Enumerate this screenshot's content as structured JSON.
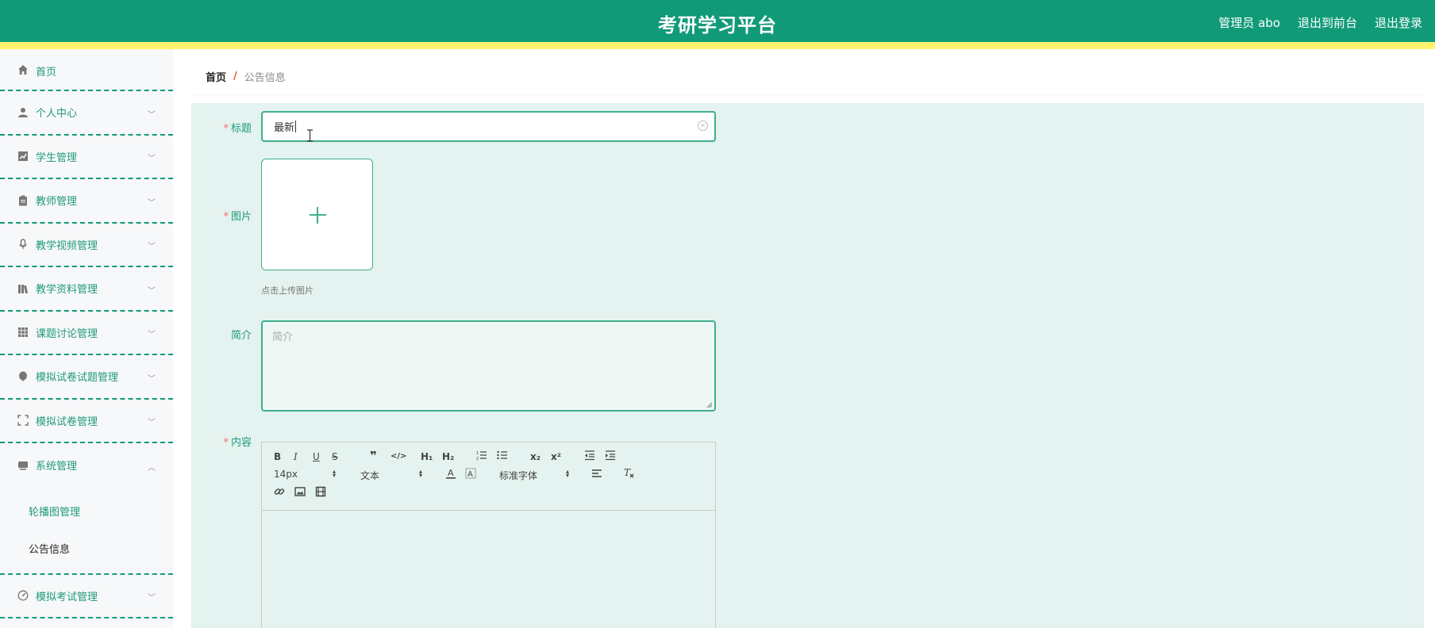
{
  "header": {
    "title": "考研学习平台",
    "user": "管理员 abo",
    "to_front": "退出到前台",
    "logout": "退出登录",
    "bg_color": "#119a78",
    "strip_color": "#fff36e"
  },
  "sidebar": {
    "home": "首页",
    "items": [
      {
        "label": "个人中心",
        "icon": "person-icon"
      },
      {
        "label": "学生管理",
        "icon": "chart-icon"
      },
      {
        "label": "教师管理",
        "icon": "clipboard-icon"
      },
      {
        "label": "教学视频管理",
        "icon": "microphone-icon"
      },
      {
        "label": "教学资料管理",
        "icon": "books-icon"
      },
      {
        "label": "课题讨论管理",
        "icon": "grid-icon"
      },
      {
        "label": "模拟试卷试题管理",
        "icon": "balloon-icon"
      },
      {
        "label": "模拟试卷管理",
        "icon": "fullscreen-icon"
      },
      {
        "label": "系统管理",
        "icon": "system-icon"
      },
      {
        "label": "模拟考试管理",
        "icon": "gauge-icon"
      }
    ],
    "submenu": [
      "轮播图管理",
      "公告信息"
    ]
  },
  "breadcrumb": {
    "home": "首页",
    "separator": "/",
    "current": "公告信息"
  },
  "form": {
    "title_label": "标题",
    "title_value": "最新",
    "image_label": "图片",
    "upload_tip": "点击上传图片",
    "intro_label": "简介",
    "intro_placeholder": "简介",
    "content_label": "内容",
    "required_mark": "*"
  },
  "editor": {
    "h1": "H₁",
    "h2": "H₂",
    "size": "14px",
    "header": "文本",
    "font": "标准字体",
    "subscript": "x₂",
    "superscript": "x²"
  },
  "colors": {
    "accent": "#119a78",
    "content_bg": "#e4f3ef",
    "required": "#f56c6c",
    "breadcrumb_sep": "#e0542d"
  }
}
